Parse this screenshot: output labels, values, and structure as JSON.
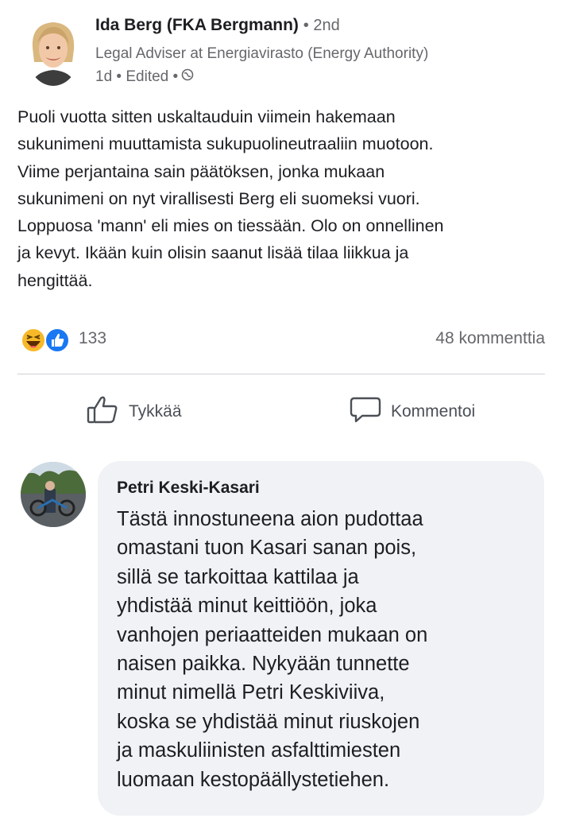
{
  "post": {
    "author_name": "Ida Berg (FKA Bergmann)",
    "connection_degree": "2nd",
    "author_title": "Legal Adviser at Energiavirasto (Energy Authority)",
    "time": "1d",
    "edited_label": "Edited",
    "visibility_icon": "globe-icon",
    "body_lines": [
      "Puoli vuotta sitten uskaltauduin viimein hakemaan",
      "sukunimeni muuttamista sukupuolineutraaliin muotoon.",
      "Viime perjantaina sain päätöksen, jonka mukaan",
      "sukunimeni on nyt virallisesti Berg eli suomeksi vuori.",
      "Loppuosa 'mann' eli mies on tiessään. Olo on onnellinen",
      "ja kevyt. Ikään kuin olisin saanut lisää tilaa liikkua ja",
      "hengittää."
    ]
  },
  "reactions": {
    "icons": [
      "haha-icon",
      "like-icon"
    ],
    "count": "133",
    "comments_count": "48 kommenttia"
  },
  "actions": {
    "like_label": "Tykkää",
    "comment_label": "Kommentoi"
  },
  "comment": {
    "author_name": "Petri Keski-Kasari",
    "text_lines": [
      "Tästä innostuneena aion pudottaa",
      "omastani tuon Kasari sanan pois,",
      "sillä se tarkoittaa kattilaa ja",
      "yhdistää minut keittiöön, joka",
      "vanhojen periaatteiden mukaan on",
      "naisen paikka. Nykyään tunnette",
      "minut nimellä Petri Keskiviiva,",
      "koska se yhdistää minut riuskojen",
      "ja maskuliinisten asfalttimiesten",
      "luomaan kestopäällystetiehen."
    ]
  },
  "colors": {
    "text": "#1c1e21",
    "secondary_text": "#65676b",
    "like_blue": "#1877f2",
    "haha_yellow": "#f7b928",
    "bubble_bg": "#f0f2f5"
  }
}
